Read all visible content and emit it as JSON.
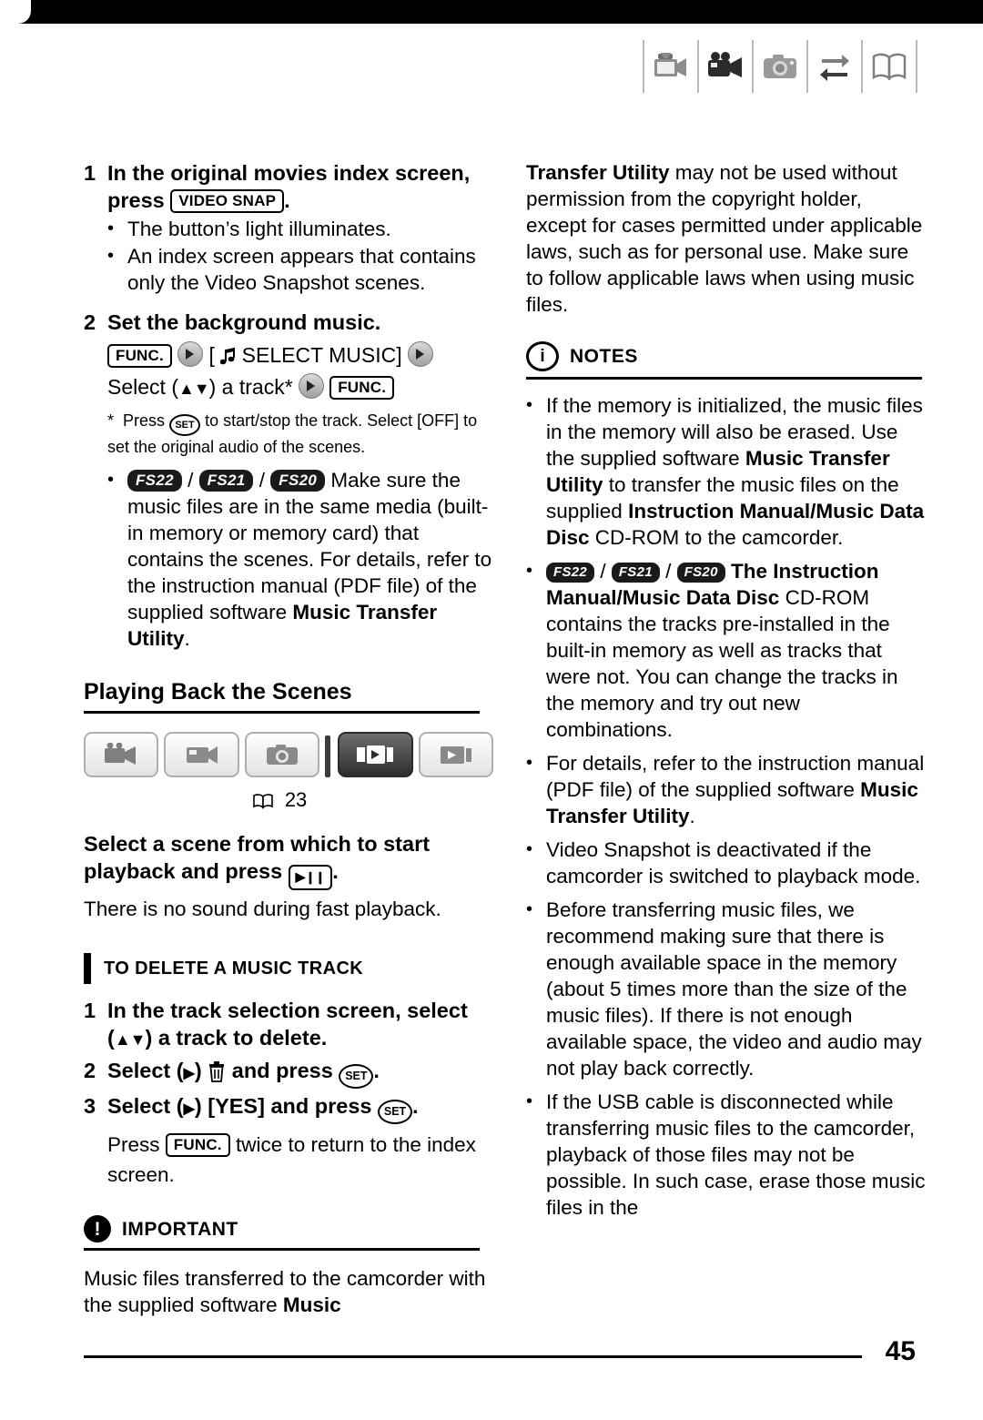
{
  "page": {
    "number": "45",
    "cross_reference": "23"
  },
  "header_icons": [
    {
      "name": "video-snapshot-icon"
    },
    {
      "name": "movie-camera-icon"
    },
    {
      "name": "photo-camera-icon"
    },
    {
      "name": "transfer-icon"
    },
    {
      "name": "manual-book-icon"
    }
  ],
  "left_column": {
    "step1": {
      "num": "1",
      "text_before": "In the original movies index screen, press",
      "key": "VIDEO SNAP",
      "text_after": "."
    },
    "step1_bullets": [
      "The button’s light illuminates.",
      "An index screen appears that contains only the Video Snapshot scenes."
    ],
    "step2": {
      "num": "2",
      "text": "Set the background music."
    },
    "menu_line_1_func": "FUNC.",
    "menu_line_1_text": "[      SELECT MUSIC]",
    "menu_line_2_a": "Select (",
    "menu_line_2_b": ") a track*",
    "menu_line_2_func": "FUNC.",
    "footnote": "*  Press      to start/stop the track. Select [OFF] to set the original audio of the scenes.",
    "footnote_set": "SET",
    "model_bullet": {
      "models": [
        "FS22",
        "FS21",
        "FS20"
      ],
      "text": "Make sure the music files are in the same media (built-in memory or memory card) that contains the scenes. For details, refer to the instruction manual (PDF file) of the supplied software ",
      "bold_tail": "Music Transfer Utility",
      "tail_period": "."
    },
    "section_heading": "Playing Back the Scenes",
    "tabs": [
      {
        "name": "tab-movie-play",
        "selected": false
      },
      {
        "name": "tab-movie-record",
        "selected": false
      },
      {
        "name": "tab-photo",
        "selected": false
      },
      {
        "name": "tab-video-snapshot-play",
        "selected": true
      },
      {
        "name": "tab-photo-play",
        "selected": false
      }
    ],
    "instruction_bold": "Select a scene from which to start playback and press",
    "instruction_bold_after": ".",
    "instruction_plain": "There is no sound during fast playback.",
    "subhead": "TO DELETE A MUSIC TRACK",
    "delete_steps": [
      {
        "num": "1",
        "text": "In the track selection screen, select (      ) a track to delete."
      },
      {
        "num": "2",
        "text_a": "Select (   )",
        "text_b": "and press",
        "text_c": "."
      },
      {
        "num": "3",
        "text_a": "Select (   ) [YES] and press",
        "text_c": "."
      }
    ],
    "delete_tail_a": "Press",
    "delete_tail_func": "FUNC.",
    "delete_tail_b": "twice to return to the index screen.",
    "important": {
      "badge": "!",
      "title": "IMPORTANT",
      "body_a": "Music files transferred to the camcorder with the supplied software ",
      "body_bold": "Music"
    }
  },
  "right_column": {
    "continued_bold": "Transfer Utility",
    "continued_text": " may not be used without permission from the copyright holder, except for cases permitted under applicable laws, such as for personal use. Make sure to follow applicable laws when using music files.",
    "notes": {
      "badge": "i",
      "title": "NOTES"
    },
    "note_items": [
      {
        "parts": [
          {
            "t": "If the memory is initialized, the music files in the memory will also be erased. Use the supplied software ",
            "b": false
          },
          {
            "t": "Music Transfer Utility",
            "b": true
          },
          {
            "t": " to transfer the music files on the supplied ",
            "b": false
          },
          {
            "t": "Instruction Manual/Music Data Disc",
            "b": true
          },
          {
            "t": " CD-ROM to the camcorder.",
            "b": false
          }
        ]
      },
      {
        "models": [
          "FS22",
          "FS21",
          "FS20"
        ],
        "parts": [
          {
            "t": "The Instruction Manual/Music Data Disc",
            "b": true
          },
          {
            "t": " CD-ROM contains the tracks pre-installed in the built-in memory as well as tracks that were not. You can change the tracks in the memory and try out new combinations.",
            "b": false
          }
        ]
      },
      {
        "parts": [
          {
            "t": "For details, refer to the instruction manual (PDF file) of the supplied software ",
            "b": false
          },
          {
            "t": "Music Transfer Utility",
            "b": true
          },
          {
            "t": ".",
            "b": false
          }
        ]
      },
      {
        "parts": [
          {
            "t": "Video Snapshot is deactivated if the camcorder is switched to playback mode.",
            "b": false
          }
        ]
      },
      {
        "parts": [
          {
            "t": "Before transferring music files, we recommend making sure that there is enough available space in the memory (about 5 times more than the size of the music files). If there is not enough available space, the video and audio may not play back correctly.",
            "b": false
          }
        ]
      },
      {
        "parts": [
          {
            "t": "If the USB cable is disconnected while transferring music files to the camcorder, playback of those files may not be possible. In such case, erase those music files in the",
            "b": false
          }
        ]
      }
    ]
  }
}
